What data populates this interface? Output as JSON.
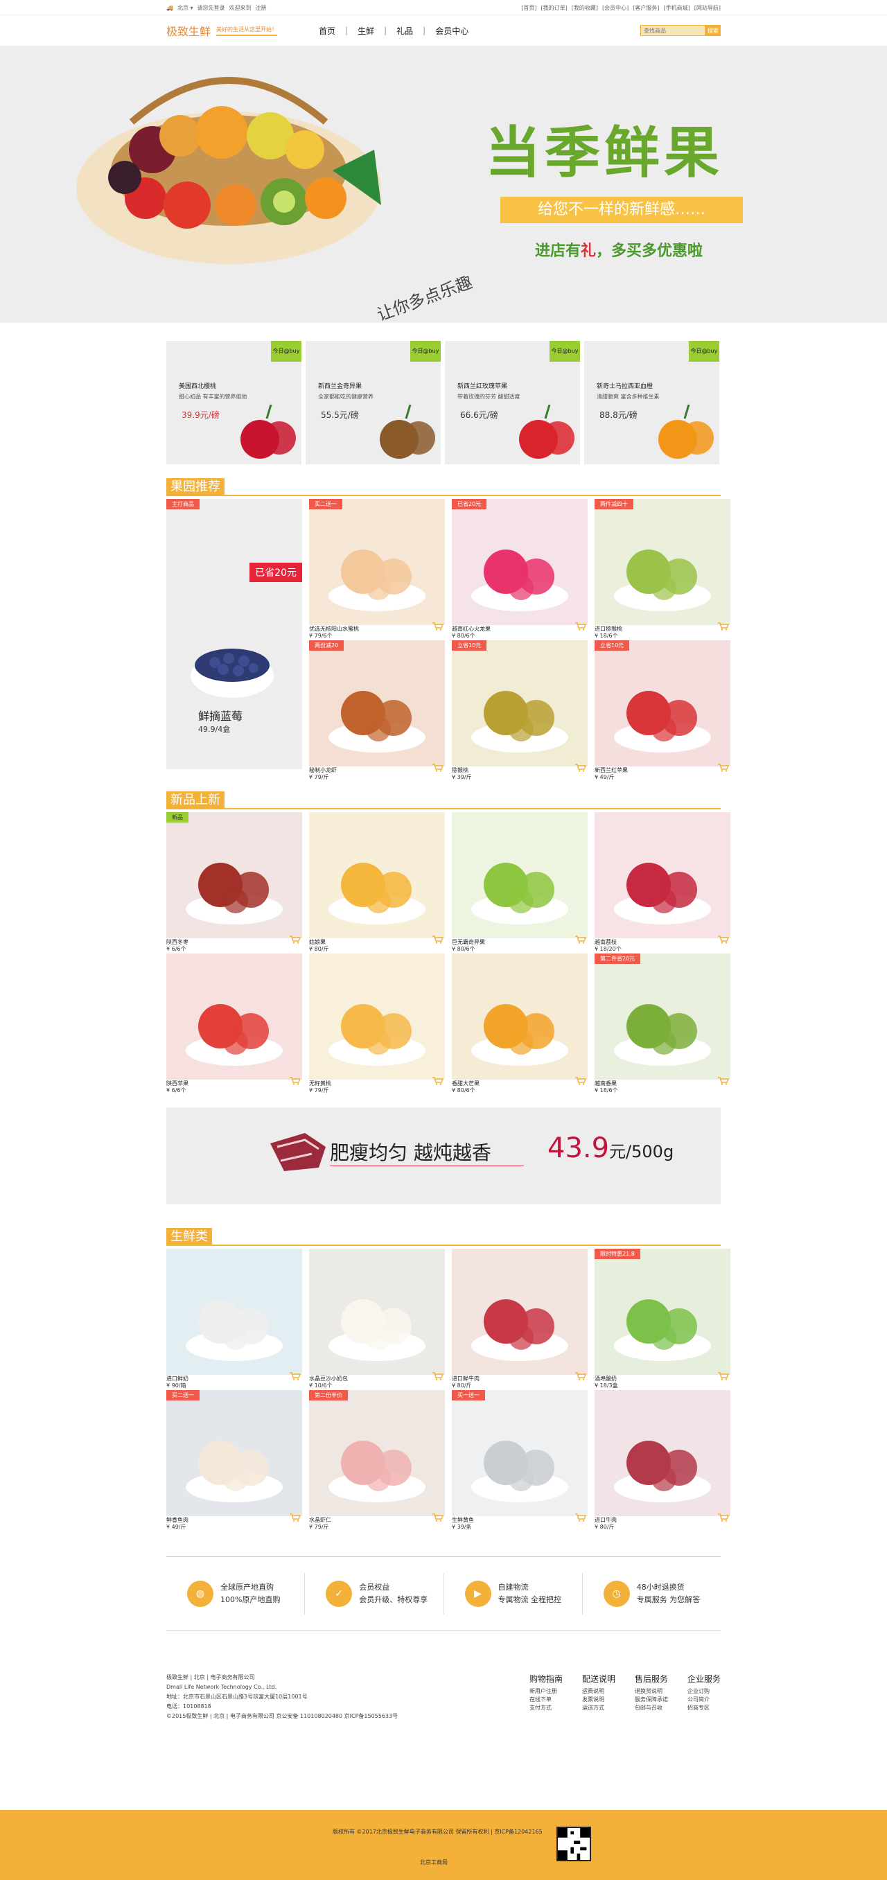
{
  "topbar": {
    "left": [
      "北京 ▾",
      "请您先登录",
      "欢迎来到",
      "注册"
    ],
    "right": [
      "[首页]",
      "[我的订单]",
      "[我的收藏]",
      "[会员中心]",
      "[客户服务]",
      "[手机商城]",
      "[网站导航]"
    ]
  },
  "header": {
    "logo_name": "极致生鲜",
    "logo_slogan": "美好的生活从这里开始！",
    "nav": [
      "首页",
      "生鲜",
      "礼品",
      "会员中心"
    ],
    "search_placeholder": "查找商品",
    "search_button": "搜索"
  },
  "banner": {
    "title": "当季鲜果",
    "bar": "给您不一样的新鲜感……",
    "promo_a": "进店有",
    "promo_red": "礼",
    "promo_b": "，多买多优惠啦",
    "fun": "让你多点乐趣"
  },
  "daily": [
    {
      "tag": "今日@buy",
      "name": "美国西北樱桃",
      "desc": "甜心初品  有丰富的营养维他",
      "price": "39.9元/磅",
      "price_red": true
    },
    {
      "tag": "今日@buy",
      "name": "新西兰金奇异果",
      "desc": "全家都能吃的健康营养",
      "price": "55.5元/磅",
      "price_red": false
    },
    {
      "tag": "今日@buy",
      "name": "新西兰红玫瑰苹果",
      "desc": "带着玫瑰的芬芳 酸甜适度",
      "price": "66.6元/磅",
      "price_red": false
    },
    {
      "tag": "今日@buy",
      "name": "新奇士马拉西亚血橙",
      "desc": "清甜脆爽 富含多种维生素",
      "price": "88.8元/磅",
      "price_red": false
    }
  ],
  "sections": {
    "orchard": "果园推荐",
    "new": "新品上新",
    "fresh": "生鲜类"
  },
  "feature": {
    "tag": "主打商品",
    "save": "已省20元",
    "name": "鲜摘蓝莓",
    "price": "49.9/4盒"
  },
  "orchard_items": [
    {
      "badge": "买二送一",
      "name": "优选无核阳山水蜜桃",
      "price": "¥ 79/6个"
    },
    {
      "badge": "已省20元",
      "name": "越南红心火龙果",
      "price": "¥ 80/6个"
    },
    {
      "badge": "两件减四十",
      "name": "进口猕猴桃",
      "price": "¥ 18/6个"
    },
    {
      "badge": "两份减20",
      "name": "秘制小龙虾",
      "price": "¥ 79/斤"
    },
    {
      "badge": "立省10元",
      "name": "猕猴桃",
      "price": "¥ 39/斤"
    },
    {
      "badge": "立省10元",
      "name": "新西兰红苹果",
      "price": "¥ 49/斤"
    }
  ],
  "new_items": [
    {
      "badge": "新品",
      "name": "陕西冬枣",
      "price": "¥ 6/6个"
    },
    {
      "badge": "",
      "name": "姑娘果",
      "price": "¥ 80/斤"
    },
    {
      "badge": "",
      "name": "巨无霸奇异果",
      "price": "¥ 80/6个"
    },
    {
      "badge": "",
      "name": "越南荔枝",
      "price": "¥ 18/20个"
    },
    {
      "badge": "",
      "name": "陕西苹果",
      "price": "¥ 6/6个"
    },
    {
      "badge": "",
      "name": "无籽黄桃",
      "price": "¥ 79/斤"
    },
    {
      "badge": "",
      "name": "香甜大芒果",
      "price": "¥ 80/6个"
    },
    {
      "badge": "第二件省20元",
      "name": "越南香果",
      "price": "¥ 18/6个"
    }
  ],
  "ad": {
    "text": "肥瘦均匀  越炖越香",
    "price": "43.9",
    "unit": "元/500g"
  },
  "fresh_items": [
    {
      "badge": "",
      "name": "进口鲜奶",
      "price": "¥ 90/箱"
    },
    {
      "badge": "",
      "name": "水晶豆沙小奶包",
      "price": "¥ 10/6个"
    },
    {
      "badge": "",
      "name": "进口鲜牛肉",
      "price": "¥ 80/斤"
    },
    {
      "badge": "限时特惠21.8",
      "name": "酒埠酸奶",
      "price": "¥ 18/3盒"
    },
    {
      "badge": "买二送一",
      "name": "鲜香鱼肉",
      "price": "¥ 49/斤"
    },
    {
      "badge": "第二份半价",
      "name": "水晶虾仁",
      "price": "¥ 79/斤"
    },
    {
      "badge": "买一送一",
      "name": "生鲜黄鱼",
      "price": "¥ 39/条"
    },
    {
      "badge": "",
      "name": "进口牛肉",
      "price": "¥ 80/斤"
    }
  ],
  "services": [
    {
      "icon": "globe-icon",
      "t1": "全球原产地直购",
      "t2": "100%原产地直购"
    },
    {
      "icon": "check-icon",
      "t1": "会员权益",
      "t2": "会员升级、特权尊享"
    },
    {
      "icon": "truck-icon",
      "t1": "自建物流",
      "t2": "专属物流 全程把控"
    },
    {
      "icon": "clock-icon",
      "t1": "48小时退换货",
      "t2": "专属服务 为您解答"
    }
  ],
  "footer": {
    "addr": [
      "极致生鲜  |  北京  |  电子商务有限公司",
      "Dmall Life Network Technology Co., Ltd.",
      "地址：北京市石景山区石景山路3号玖富大厦10层1001号",
      "电话：10108818",
      "©2015极致生鲜  |  北京  |  电子商务有限公司   京公安备  110108020480  京ICP备15055633号"
    ],
    "cols": [
      {
        "h": "购物指南",
        "l": [
          "新用户注册",
          "在线下单",
          "支付方式"
        ]
      },
      {
        "h": "配送说明",
        "l": [
          "运费说明",
          "发票说明",
          "运送方式"
        ]
      },
      {
        "h": "售后服务",
        "l": [
          "退换货说明",
          "服务保障承诺",
          "包邮与召收"
        ]
      },
      {
        "h": "企业服务",
        "l": [
          "企业订购",
          "公司简介",
          "招商专区"
        ]
      }
    ],
    "copyright": "版权所有 ©2017北京极致生鲜电子商务有限公司  保留所有权利  |  京ICP备12042165",
    "copyright2": "北京工商局"
  }
}
